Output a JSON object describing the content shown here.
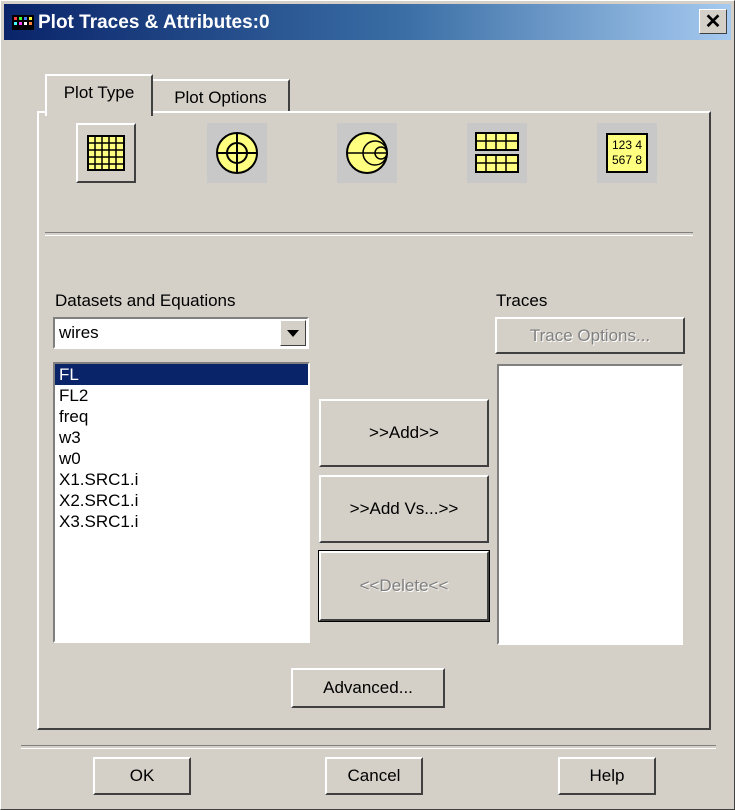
{
  "window": {
    "title": "Plot Traces & Attributes:0",
    "close": "✕"
  },
  "tabs": [
    {
      "label": "Plot Type"
    },
    {
      "label": "Plot Options"
    }
  ],
  "plot_types": [
    {
      "icon": "rectangular-grid-icon",
      "selected": true
    },
    {
      "icon": "polar-plot-icon",
      "selected": false
    },
    {
      "icon": "smith-chart-icon",
      "selected": false
    },
    {
      "icon": "stacked-grid-icon",
      "selected": false
    },
    {
      "icon": "tabular-numbers-icon",
      "selected": false,
      "text_line1": "123 4",
      "text_line2": "567 8"
    }
  ],
  "datasets": {
    "label": "Datasets and Equations",
    "selected": "wires",
    "items": [
      "FL",
      "FL2",
      "freq",
      "w3",
      "w0",
      "X1.SRC1.i",
      "X2.SRC1.i",
      "X3.SRC1.i"
    ],
    "selected_index": 0
  },
  "traces": {
    "label": "Traces",
    "options_button": "Trace Options...",
    "items": []
  },
  "buttons": {
    "add": ">>Add>>",
    "add_vs": ">>Add Vs...>>",
    "delete": "<<Delete<<",
    "advanced": "Advanced...",
    "ok": "OK",
    "cancel": "Cancel",
    "help": "Help"
  },
  "colors": {
    "title_start": "#0a246a",
    "title_end": "#a6caf0",
    "icon_fill": "#ffff80",
    "dialog_bg": "#d4d0c8",
    "selection": "#0a246a"
  }
}
